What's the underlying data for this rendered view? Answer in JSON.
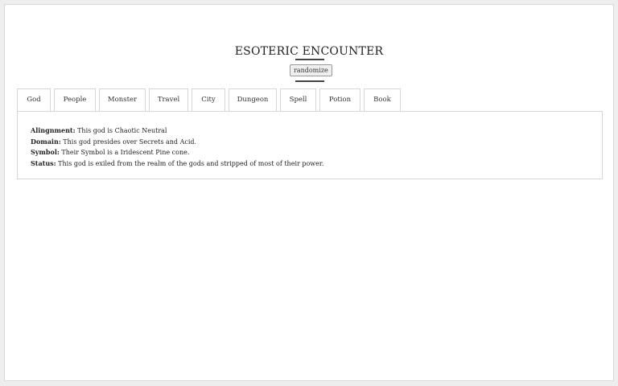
{
  "header": {
    "title": "ESOTERIC ENCOUNTER",
    "randomize_label": "randomize"
  },
  "tabs": [
    {
      "label": "God"
    },
    {
      "label": "People"
    },
    {
      "label": "Monster"
    },
    {
      "label": "Travel"
    },
    {
      "label": "City"
    },
    {
      "label": "Dungeon"
    },
    {
      "label": "Spell"
    },
    {
      "label": "Potion"
    },
    {
      "label": "Book"
    }
  ],
  "content": {
    "lines": [
      {
        "label": "Alingnment:",
        "text": "This god is Chaotic Neutral"
      },
      {
        "label": "Domain:",
        "text": "This god presides over Secrets and Acid."
      },
      {
        "label": "Symbol:",
        "text": "Their Symbol is a Iridescent Pine cone."
      },
      {
        "label": "Status:",
        "text": "This god is exiled from the realm of the gods and stripped of most of their power."
      }
    ]
  }
}
